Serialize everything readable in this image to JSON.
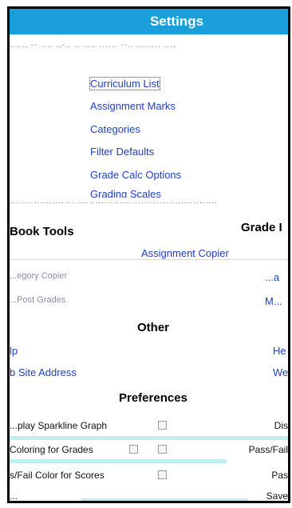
{
  "window": {
    "title": "Settings"
  },
  "settings_links": [
    "Curriculum List",
    "Assignment Marks",
    "Categories",
    "Filter Defaults",
    "Grade Calc Options",
    "Grading Scales"
  ],
  "sections": {
    "book_tools": "Book Tools",
    "grade": "Grade I",
    "other": "Other",
    "preferences": "Preferences"
  },
  "book_tools": {
    "assignment_copier": "Assignment Copier",
    "category_copier": "...egory Copier",
    "post_grades": "...Post Grades"
  },
  "grade_col": {
    "item1": "...a",
    "item2": "M..."
  },
  "other": {
    "help_left": "lp",
    "website_left": "b Site Address",
    "help_right": "He",
    "website_right": "We"
  },
  "preferences": [
    {
      "label": "...play Sparkline Graph",
      "right": "Dis"
    },
    {
      "label": "Coloring for Grades",
      "right": "Pass/Fail"
    },
    {
      "label": "s/Fail Color for Scores",
      "right": "Pas"
    },
    {
      "label": "...",
      "right": "Save"
    }
  ],
  "colors": {
    "title_bar": "#1a9fdb",
    "link": "#1f3fbf",
    "glitch": "#bdeef2"
  }
}
